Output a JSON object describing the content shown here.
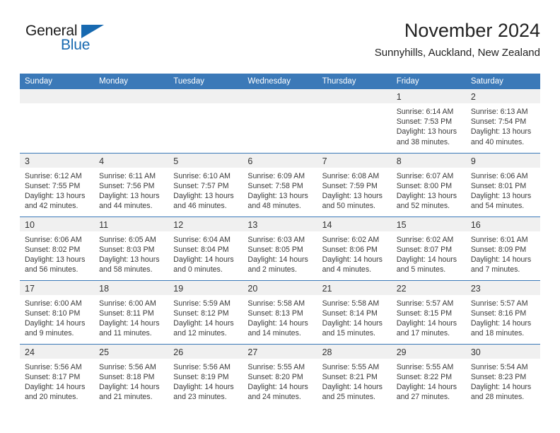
{
  "brand": {
    "name_part1": "General",
    "name_part2": "Blue",
    "accent_color": "#1769b0"
  },
  "header": {
    "title": "November 2024",
    "subtitle": "Sunnyhills, Auckland, New Zealand"
  },
  "theme": {
    "header_blue": "#3b79b8",
    "date_band_gray": "#f0f0f0",
    "text_color": "#3a3a3a"
  },
  "calendar": {
    "day_headers": [
      "Sunday",
      "Monday",
      "Tuesday",
      "Wednesday",
      "Thursday",
      "Friday",
      "Saturday"
    ],
    "weeks": [
      [
        {
          "day": "",
          "empty": true
        },
        {
          "day": "",
          "empty": true
        },
        {
          "day": "",
          "empty": true
        },
        {
          "day": "",
          "empty": true
        },
        {
          "day": "",
          "empty": true
        },
        {
          "day": "1",
          "sunrise": "Sunrise: 6:14 AM",
          "sunset": "Sunset: 7:53 PM",
          "daylight_line1": "Daylight: 13 hours",
          "daylight_line2": "and 38 minutes."
        },
        {
          "day": "2",
          "sunrise": "Sunrise: 6:13 AM",
          "sunset": "Sunset: 7:54 PM",
          "daylight_line1": "Daylight: 13 hours",
          "daylight_line2": "and 40 minutes."
        }
      ],
      [
        {
          "day": "3",
          "sunrise": "Sunrise: 6:12 AM",
          "sunset": "Sunset: 7:55 PM",
          "daylight_line1": "Daylight: 13 hours",
          "daylight_line2": "and 42 minutes."
        },
        {
          "day": "4",
          "sunrise": "Sunrise: 6:11 AM",
          "sunset": "Sunset: 7:56 PM",
          "daylight_line1": "Daylight: 13 hours",
          "daylight_line2": "and 44 minutes."
        },
        {
          "day": "5",
          "sunrise": "Sunrise: 6:10 AM",
          "sunset": "Sunset: 7:57 PM",
          "daylight_line1": "Daylight: 13 hours",
          "daylight_line2": "and 46 minutes."
        },
        {
          "day": "6",
          "sunrise": "Sunrise: 6:09 AM",
          "sunset": "Sunset: 7:58 PM",
          "daylight_line1": "Daylight: 13 hours",
          "daylight_line2": "and 48 minutes."
        },
        {
          "day": "7",
          "sunrise": "Sunrise: 6:08 AM",
          "sunset": "Sunset: 7:59 PM",
          "daylight_line1": "Daylight: 13 hours",
          "daylight_line2": "and 50 minutes."
        },
        {
          "day": "8",
          "sunrise": "Sunrise: 6:07 AM",
          "sunset": "Sunset: 8:00 PM",
          "daylight_line1": "Daylight: 13 hours",
          "daylight_line2": "and 52 minutes."
        },
        {
          "day": "9",
          "sunrise": "Sunrise: 6:06 AM",
          "sunset": "Sunset: 8:01 PM",
          "daylight_line1": "Daylight: 13 hours",
          "daylight_line2": "and 54 minutes."
        }
      ],
      [
        {
          "day": "10",
          "sunrise": "Sunrise: 6:06 AM",
          "sunset": "Sunset: 8:02 PM",
          "daylight_line1": "Daylight: 13 hours",
          "daylight_line2": "and 56 minutes."
        },
        {
          "day": "11",
          "sunrise": "Sunrise: 6:05 AM",
          "sunset": "Sunset: 8:03 PM",
          "daylight_line1": "Daylight: 13 hours",
          "daylight_line2": "and 58 minutes."
        },
        {
          "day": "12",
          "sunrise": "Sunrise: 6:04 AM",
          "sunset": "Sunset: 8:04 PM",
          "daylight_line1": "Daylight: 14 hours",
          "daylight_line2": "and 0 minutes."
        },
        {
          "day": "13",
          "sunrise": "Sunrise: 6:03 AM",
          "sunset": "Sunset: 8:05 PM",
          "daylight_line1": "Daylight: 14 hours",
          "daylight_line2": "and 2 minutes."
        },
        {
          "day": "14",
          "sunrise": "Sunrise: 6:02 AM",
          "sunset": "Sunset: 8:06 PM",
          "daylight_line1": "Daylight: 14 hours",
          "daylight_line2": "and 4 minutes."
        },
        {
          "day": "15",
          "sunrise": "Sunrise: 6:02 AM",
          "sunset": "Sunset: 8:07 PM",
          "daylight_line1": "Daylight: 14 hours",
          "daylight_line2": "and 5 minutes."
        },
        {
          "day": "16",
          "sunrise": "Sunrise: 6:01 AM",
          "sunset": "Sunset: 8:09 PM",
          "daylight_line1": "Daylight: 14 hours",
          "daylight_line2": "and 7 minutes."
        }
      ],
      [
        {
          "day": "17",
          "sunrise": "Sunrise: 6:00 AM",
          "sunset": "Sunset: 8:10 PM",
          "daylight_line1": "Daylight: 14 hours",
          "daylight_line2": "and 9 minutes."
        },
        {
          "day": "18",
          "sunrise": "Sunrise: 6:00 AM",
          "sunset": "Sunset: 8:11 PM",
          "daylight_line1": "Daylight: 14 hours",
          "daylight_line2": "and 11 minutes."
        },
        {
          "day": "19",
          "sunrise": "Sunrise: 5:59 AM",
          "sunset": "Sunset: 8:12 PM",
          "daylight_line1": "Daylight: 14 hours",
          "daylight_line2": "and 12 minutes."
        },
        {
          "day": "20",
          "sunrise": "Sunrise: 5:58 AM",
          "sunset": "Sunset: 8:13 PM",
          "daylight_line1": "Daylight: 14 hours",
          "daylight_line2": "and 14 minutes."
        },
        {
          "day": "21",
          "sunrise": "Sunrise: 5:58 AM",
          "sunset": "Sunset: 8:14 PM",
          "daylight_line1": "Daylight: 14 hours",
          "daylight_line2": "and 15 minutes."
        },
        {
          "day": "22",
          "sunrise": "Sunrise: 5:57 AM",
          "sunset": "Sunset: 8:15 PM",
          "daylight_line1": "Daylight: 14 hours",
          "daylight_line2": "and 17 minutes."
        },
        {
          "day": "23",
          "sunrise": "Sunrise: 5:57 AM",
          "sunset": "Sunset: 8:16 PM",
          "daylight_line1": "Daylight: 14 hours",
          "daylight_line2": "and 18 minutes."
        }
      ],
      [
        {
          "day": "24",
          "sunrise": "Sunrise: 5:56 AM",
          "sunset": "Sunset: 8:17 PM",
          "daylight_line1": "Daylight: 14 hours",
          "daylight_line2": "and 20 minutes."
        },
        {
          "day": "25",
          "sunrise": "Sunrise: 5:56 AM",
          "sunset": "Sunset: 8:18 PM",
          "daylight_line1": "Daylight: 14 hours",
          "daylight_line2": "and 21 minutes."
        },
        {
          "day": "26",
          "sunrise": "Sunrise: 5:56 AM",
          "sunset": "Sunset: 8:19 PM",
          "daylight_line1": "Daylight: 14 hours",
          "daylight_line2": "and 23 minutes."
        },
        {
          "day": "27",
          "sunrise": "Sunrise: 5:55 AM",
          "sunset": "Sunset: 8:20 PM",
          "daylight_line1": "Daylight: 14 hours",
          "daylight_line2": "and 24 minutes."
        },
        {
          "day": "28",
          "sunrise": "Sunrise: 5:55 AM",
          "sunset": "Sunset: 8:21 PM",
          "daylight_line1": "Daylight: 14 hours",
          "daylight_line2": "and 25 minutes."
        },
        {
          "day": "29",
          "sunrise": "Sunrise: 5:55 AM",
          "sunset": "Sunset: 8:22 PM",
          "daylight_line1": "Daylight: 14 hours",
          "daylight_line2": "and 27 minutes."
        },
        {
          "day": "30",
          "sunrise": "Sunrise: 5:54 AM",
          "sunset": "Sunset: 8:23 PM",
          "daylight_line1": "Daylight: 14 hours",
          "daylight_line2": "and 28 minutes."
        }
      ]
    ]
  }
}
